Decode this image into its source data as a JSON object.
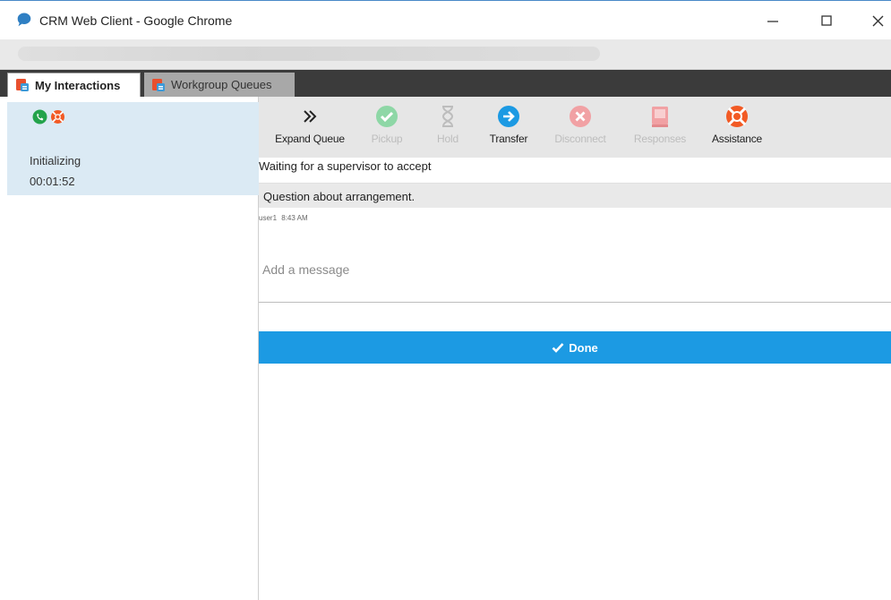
{
  "window": {
    "title": "CRM Web Client - Google Chrome"
  },
  "tabs": [
    {
      "label": "My Interactions",
      "active": true
    },
    {
      "label": "Workgroup Queues",
      "active": false
    }
  ],
  "interaction": {
    "state": "Initializing",
    "timer": "00:01:52",
    "icons": [
      "phone-icon",
      "lifebuoy-icon"
    ]
  },
  "toolbar": {
    "buttons": [
      {
        "label": "Expand Queue",
        "icon": "double-chevron-right-icon",
        "enabled": true
      },
      {
        "label": "Pickup",
        "icon": "check-circle-icon",
        "enabled": false
      },
      {
        "label": "Hold",
        "icon": "hourglass-icon",
        "enabled": false
      },
      {
        "label": "Transfer",
        "icon": "arrow-right-circle-icon",
        "enabled": true
      },
      {
        "label": "Disconnect",
        "icon": "x-circle-icon",
        "enabled": false
      },
      {
        "label": "Responses",
        "icon": "book-icon",
        "enabled": false
      },
      {
        "label": "Assistance",
        "icon": "lifebuoy-icon",
        "enabled": true
      }
    ]
  },
  "conversation": {
    "status": "Waiting for a supervisor to accept",
    "message": "Question about arrangement.",
    "author": "user1",
    "time": "8:43 AM"
  },
  "composer": {
    "placeholder": "Add a message"
  },
  "done_button": {
    "label": "Done"
  },
  "colors": {
    "accent": "#1c9ae3",
    "selected_row": "#dbeaf4",
    "tab_bar": "#3b3b3b"
  }
}
